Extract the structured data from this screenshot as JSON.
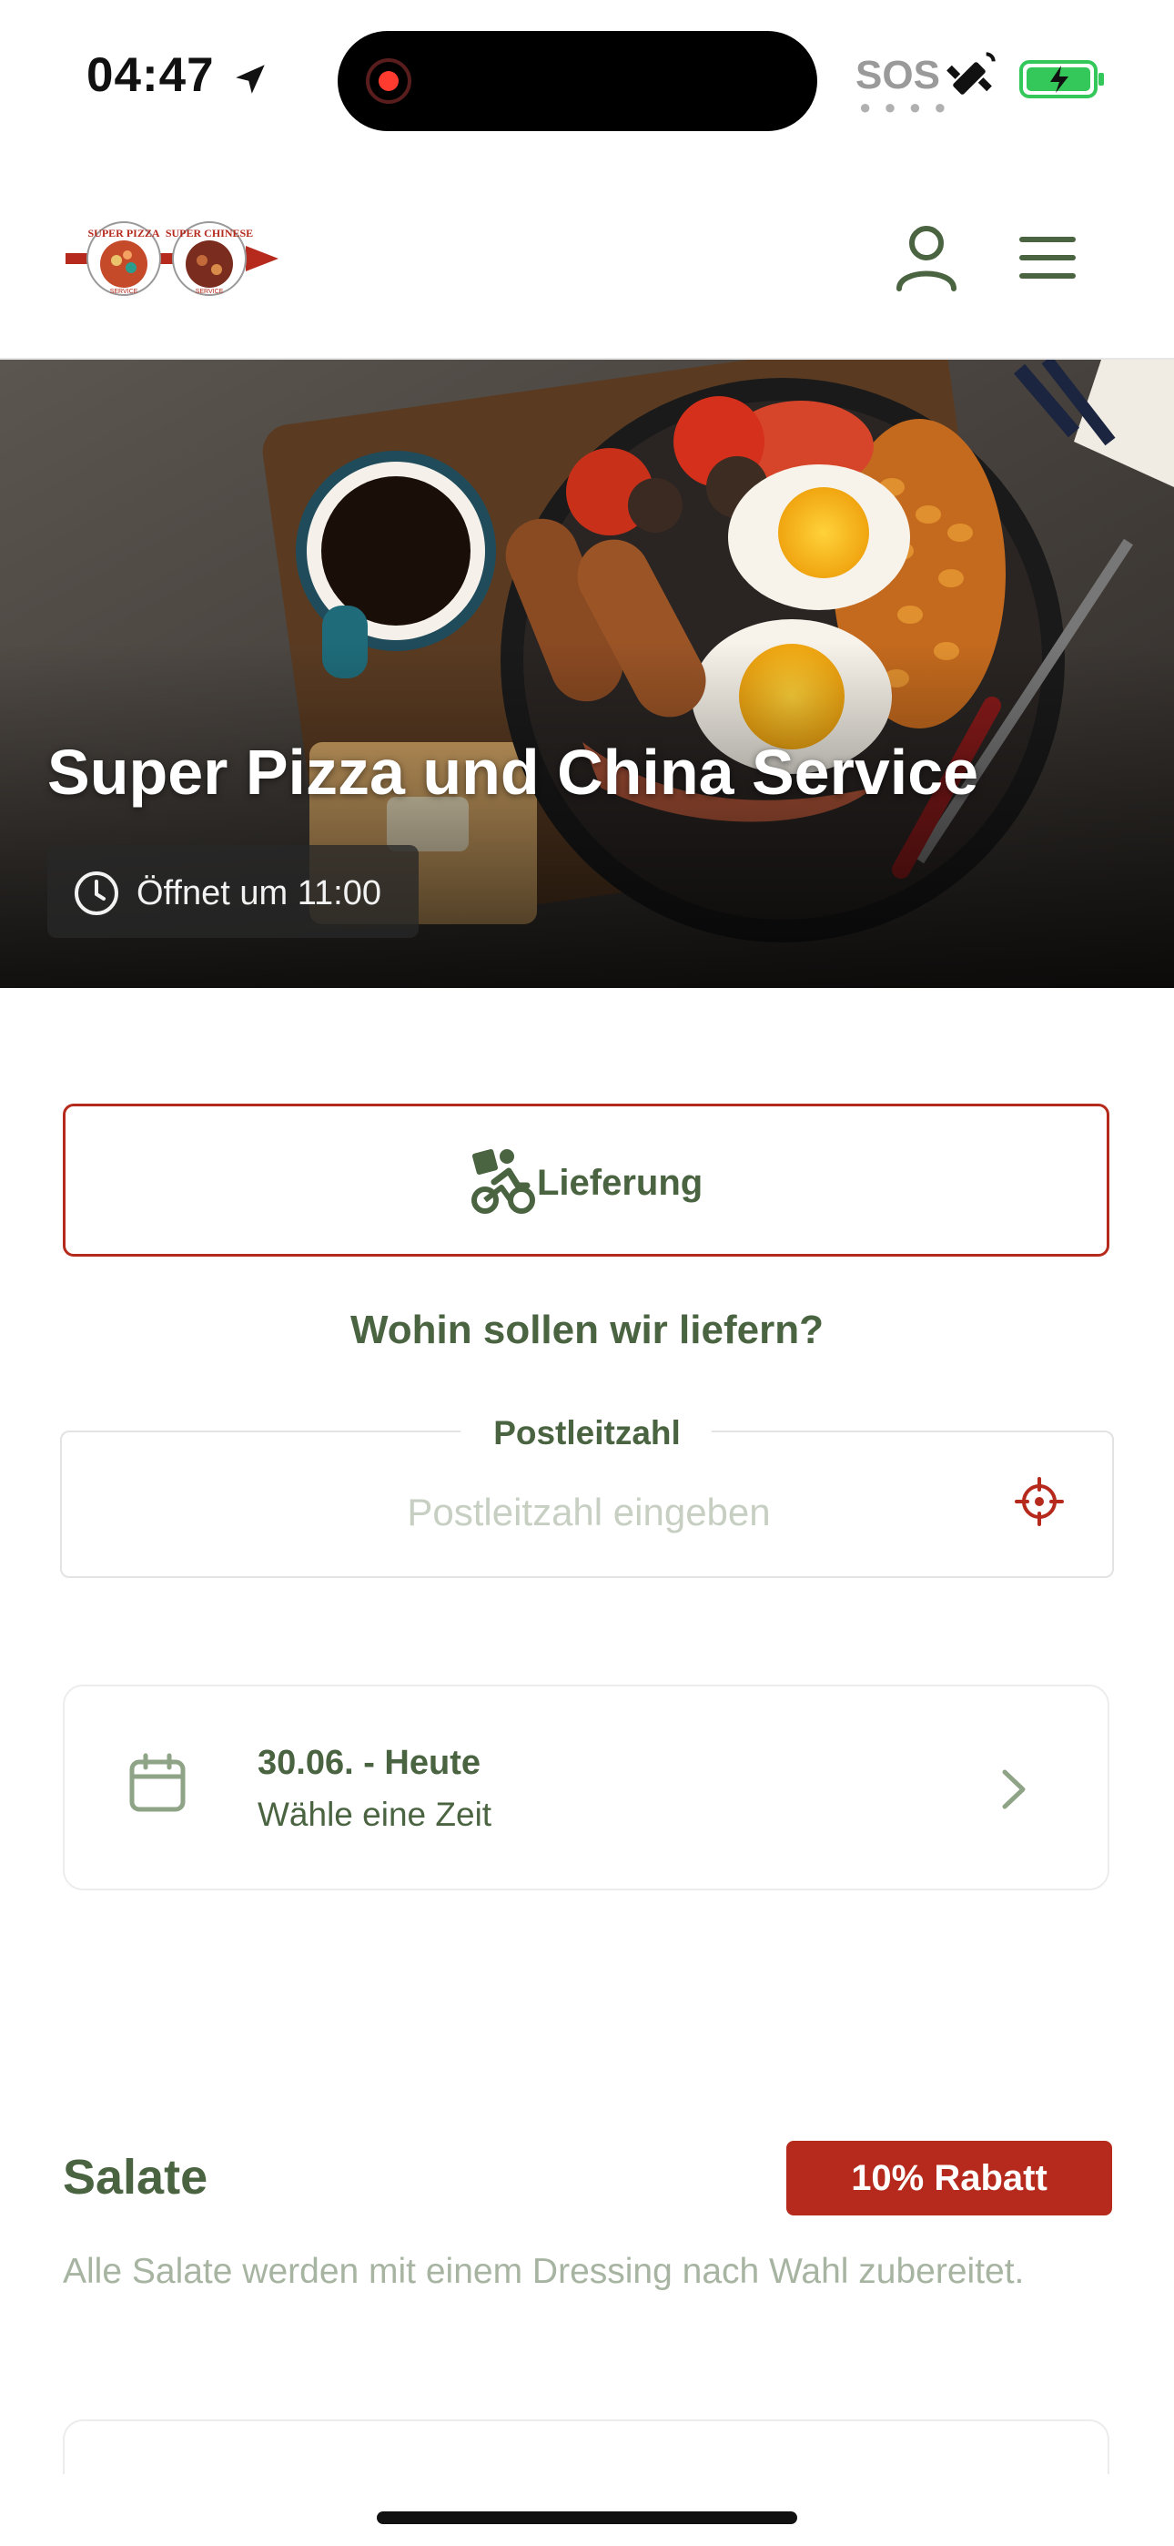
{
  "status_bar": {
    "time": "04:47",
    "sos": "SOS",
    "icons": [
      "location-arrow-icon",
      "satellite-icon",
      "battery-charging-icon"
    ],
    "battery_color": "#34c759"
  },
  "header": {
    "logo_left": "SUPER PIZZA",
    "logo_right": "SUPER CHINESE",
    "logo_sub": "SERVICE",
    "icons": [
      "user-icon",
      "menu-icon"
    ]
  },
  "hero": {
    "title": "Super Pizza und China Service",
    "hours": "Öffnet um 11:00"
  },
  "delivery": {
    "mode_label": "Lieferung",
    "question": "Wohin sollen wir liefern?",
    "postal_label": "Postleitzahl",
    "postal_placeholder": "Postleitzahl eingeben",
    "postal_value": ""
  },
  "schedule": {
    "date": "30.06. - Heute",
    "subtitle": "Wähle eine Zeit"
  },
  "category": {
    "title": "Salate",
    "badge": "10% Rabatt",
    "description": "Alle Salate werden mit einem Dressing nach Wahl zubereitet."
  },
  "colors": {
    "primary_green": "#4a6340",
    "accent_red": "#b52a1c"
  }
}
